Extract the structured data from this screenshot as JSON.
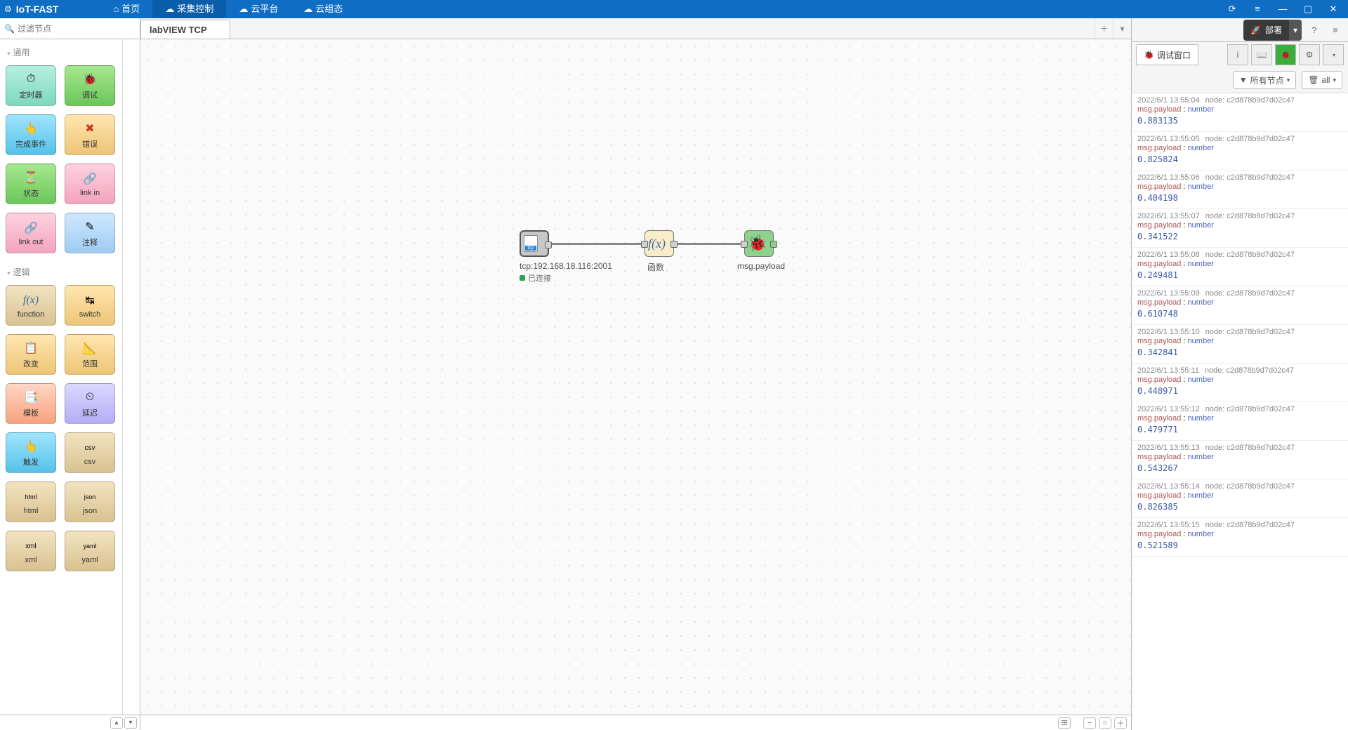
{
  "app": {
    "brand": "IoT-FAST"
  },
  "nav": {
    "home": "首页",
    "collect": "采集控制",
    "cloud": "云平台",
    "scada": "云组态"
  },
  "palette": {
    "search_placeholder": "过滤节点",
    "cat_common": "通用",
    "cat_logic": "逻辑",
    "n_timer": "定时器",
    "n_debug": "调试",
    "n_complete": "完成事件",
    "n_error": "错误",
    "n_status": "状态",
    "n_linkin": "link in",
    "n_linkout": "link out",
    "n_comment": "注释",
    "n_function": "function",
    "n_switch": "switch",
    "n_change": "改变",
    "n_range": "范围",
    "n_template": "模板",
    "n_delay": "延迟",
    "n_trigger": "触发",
    "n_csv": "csv",
    "n_html": "html",
    "n_json": "json",
    "n_xml": "xml",
    "n_yaml": "yaml"
  },
  "tab": {
    "name": "labVIEW TCP"
  },
  "canvas": {
    "tcp_label": "tcp:192.168.18.116:2001",
    "tcp_status": "已连接",
    "func_label": "函数",
    "debug_label": "msg.payload"
  },
  "deploy": {
    "label": "部署"
  },
  "debugPanel": {
    "title": "调试窗口",
    "filter_all_nodes": "所有节点",
    "filter_all": "all",
    "payload_key": "msg.payload",
    "type_label": "number",
    "node_prefix": "node:",
    "node_id": "c2d878b9d7d02c47"
  },
  "messages": [
    {
      "ts": "2022/6/1 13:55:04",
      "val": "0.883135"
    },
    {
      "ts": "2022/6/1 13:55:05",
      "val": "0.825824"
    },
    {
      "ts": "2022/6/1 13:55:06",
      "val": "0.404198"
    },
    {
      "ts": "2022/6/1 13:55:07",
      "val": "0.341522"
    },
    {
      "ts": "2022/6/1 13:55:08",
      "val": "0.249481"
    },
    {
      "ts": "2022/6/1 13:55:09",
      "val": "0.610748"
    },
    {
      "ts": "2022/6/1 13:55:10",
      "val": "0.342841"
    },
    {
      "ts": "2022/6/1 13:55:11",
      "val": "0.448971"
    },
    {
      "ts": "2022/6/1 13:55:12",
      "val": "0.479771"
    },
    {
      "ts": "2022/6/1 13:55:13",
      "val": "0.543267"
    },
    {
      "ts": "2022/6/1 13:55:14",
      "val": "0.826385"
    },
    {
      "ts": "2022/6/1 13:55:15",
      "val": "0.521589"
    }
  ]
}
